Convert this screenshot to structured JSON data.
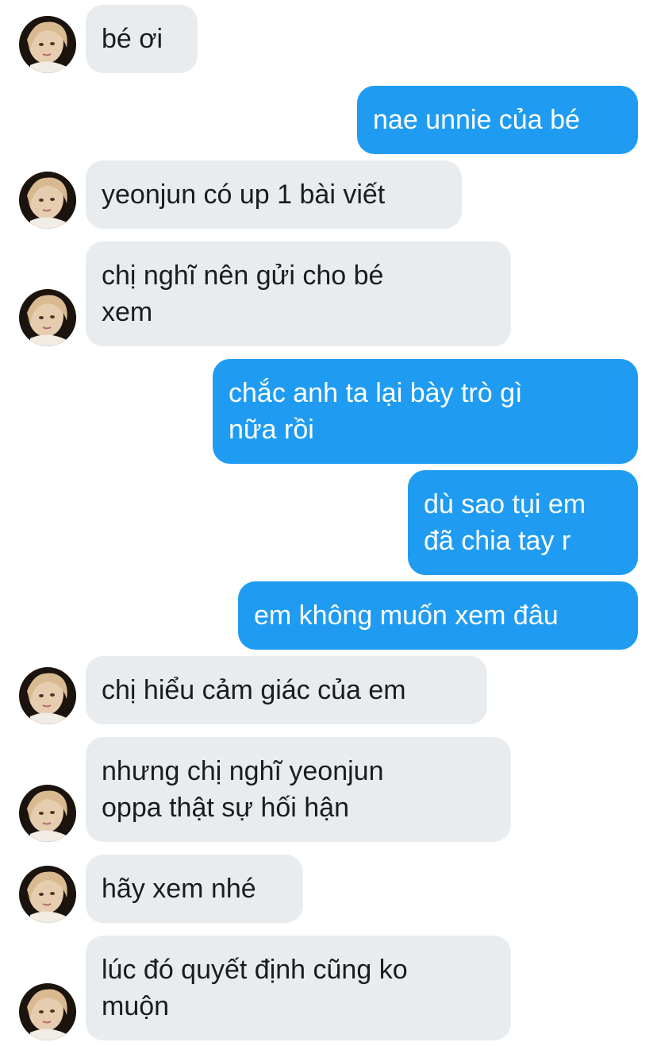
{
  "messages": [
    {
      "sender": "them",
      "lines": [
        "bé ơi"
      ]
    },
    {
      "sender": "me",
      "lines": [
        "nae unnie của bé"
      ]
    },
    {
      "sender": "them",
      "lines": [
        "yeonjun có up 1 bài viết"
      ]
    },
    {
      "sender": "them",
      "lines": [
        "chị nghĩ nên gửi cho bé",
        "xem"
      ]
    },
    {
      "sender": "me",
      "lines": [
        "chắc anh ta lại bày trò gì",
        "nữa rồi"
      ]
    },
    {
      "sender": "me",
      "lines": [
        "dù sao tụi em",
        "đã chia tay r"
      ]
    },
    {
      "sender": "me",
      "lines": [
        "em không muốn xem đâu"
      ]
    },
    {
      "sender": "them",
      "lines": [
        "chị hiểu cảm giác của em"
      ]
    },
    {
      "sender": "them",
      "lines": [
        "nhưng chị nghĩ yeonjun",
        "oppa thật sự hối hận"
      ]
    },
    {
      "sender": "them",
      "lines": [
        "hãy xem nhé"
      ]
    },
    {
      "sender": "them",
      "lines": [
        "lúc đó quyết định cũng ko",
        "muộn"
      ]
    }
  ],
  "colors": {
    "incoming_bubble": "#e9ecef",
    "outgoing_bubble": "#1f9cf2",
    "incoming_text": "#1c1c1e",
    "outgoing_text": "#ffffff"
  },
  "icons": {
    "avatar": "contact-avatar-photo"
  }
}
